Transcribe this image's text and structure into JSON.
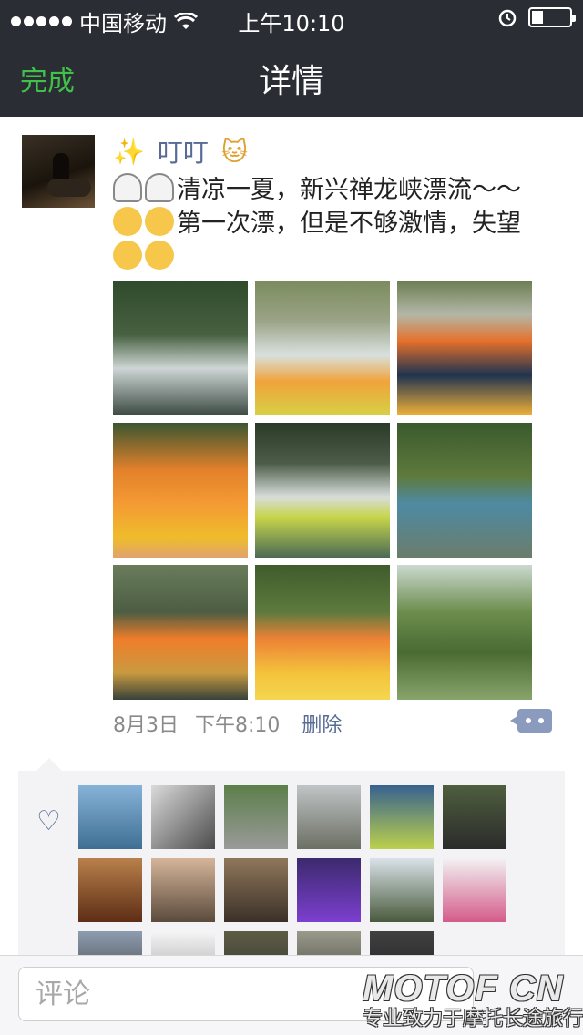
{
  "status_bar": {
    "carrier": "中国移动",
    "time": "上午10:10",
    "signal_dots": 5
  },
  "nav": {
    "done_label": "完成",
    "title": "详情"
  },
  "post": {
    "author": "叮叮",
    "text_part1": "清凉一夏，新兴禅龙峡漂流～～",
    "text_part2": "第一次漂，但是不够激情，失望",
    "date": "8月3日",
    "time": "下午8:10",
    "delete_label": "删除",
    "photo_count": 9
  },
  "likes": {
    "avatar_count": 17
  },
  "comment_box": {
    "placeholder": "评论"
  },
  "watermark": {
    "brand": "MOTOF CN",
    "slogan": "专业致力于摩托长途旅行"
  },
  "colors": {
    "bar_bg": "#2a2d33",
    "done_green": "#41c14a",
    "link_blue": "#576b95"
  }
}
